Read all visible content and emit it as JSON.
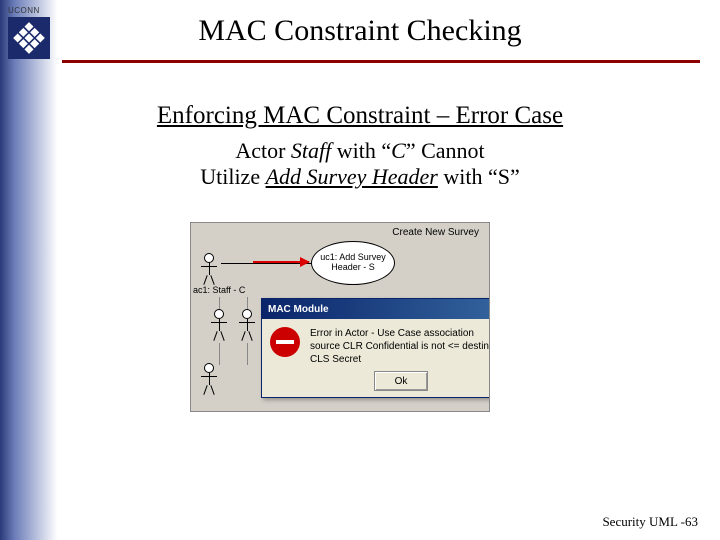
{
  "logo": {
    "org": "UCONN"
  },
  "title": "MAC Constraint Checking",
  "subtitle1": "Enforcing MAC Constraint – Error Case",
  "subtitle2_pre": "Actor ",
  "subtitle2_em": "Staff",
  "subtitle2_mid": " with “",
  "subtitle2_c": "C",
  "subtitle2_post": "” Cannot",
  "subtitle3_pre": "Utilize ",
  "subtitle3_em": "Add Survey Header",
  "subtitle3_post": " with “S”",
  "diagram": {
    "topLabel": "Create New Survey",
    "usecase": "uc1: Add Survey Header - S",
    "actorLabel": "ac1: Staff - C"
  },
  "dialog": {
    "title": "MAC Module",
    "line1": "Error in Actor - Use Case association",
    "line2": "source CLR Confidential is not <= destination CLS Secret",
    "ok": "Ok",
    "close": "×"
  },
  "footer": "Security UML -63"
}
